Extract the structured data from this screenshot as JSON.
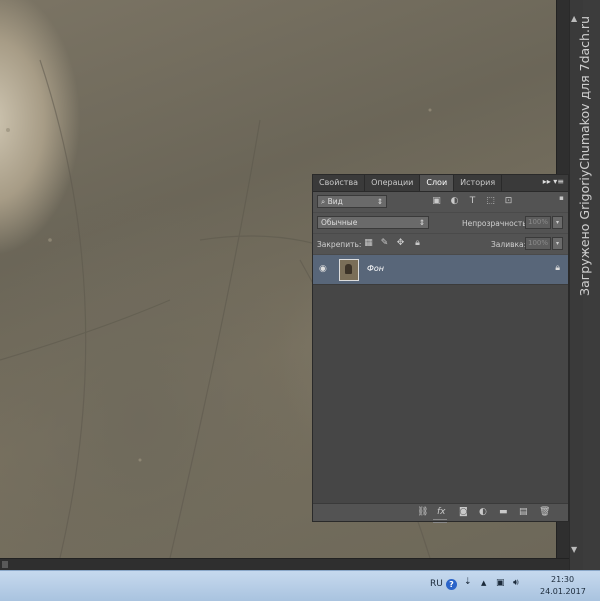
{
  "layers_panel": {
    "tabs": [
      {
        "label": "Свойства",
        "active": false
      },
      {
        "label": "Операции",
        "active": false
      },
      {
        "label": "Слои",
        "active": true
      },
      {
        "label": "История",
        "active": false
      }
    ],
    "filter": {
      "kind_label": "Вид"
    },
    "blend_mode": "Обычные",
    "opacity_label": "Непрозрачность:",
    "opacity_value": "100%",
    "lock_label": "Закрепить:",
    "fill_label": "Заливка:",
    "fill_value": "100%",
    "layers": [
      {
        "name": "Фон",
        "visible": true,
        "locked": true,
        "selected": true
      }
    ]
  },
  "taskbar": {
    "language": "RU",
    "time": "21:30",
    "date": "24.01.2017"
  },
  "watermark": "Загружено GrigoriyChumakov для 7dach.ru",
  "colors": {
    "panel_bg": "#535353",
    "selected_layer": "#586679",
    "taskbar": "#b8cfe8"
  }
}
